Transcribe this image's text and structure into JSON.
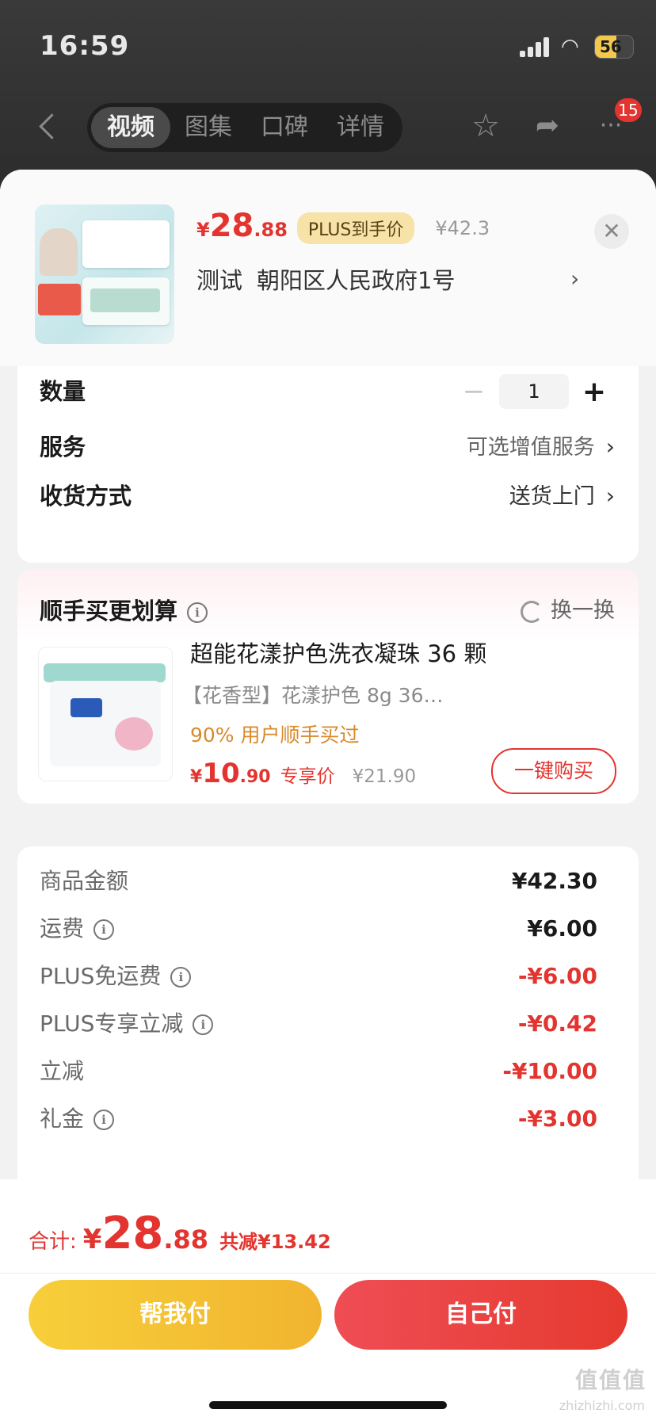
{
  "status": {
    "time": "16:59",
    "battery": "56",
    "battery_level": 0.56
  },
  "nav": {
    "tabs": [
      "视频",
      "图集",
      "口碑",
      "详情"
    ],
    "badge": "15"
  },
  "product": {
    "price_yen": "¥",
    "price_int": "28",
    "price_dec": ".88",
    "plus_label": "PLUS到手价",
    "original_price": "¥42.3",
    "address_name": "测试",
    "address": "朝阳区人民政府1号",
    "chevron": "›"
  },
  "options": {
    "quantity_label": "数量",
    "quantity": "1",
    "minus": "−",
    "plus": "+",
    "service_label": "服务",
    "service_value": "可选增值服务",
    "delivery_label": "收货方式",
    "delivery_value": "送货上门",
    "chevron": "›"
  },
  "recommend": {
    "title": "顺手买更划算",
    "refresh": "换一换",
    "info": "i",
    "item": {
      "name": "超能花漾护色洗衣凝珠 36 颗",
      "spec": "【花香型】花漾护色 8g 36…",
      "bought": "90% 用户顺手买过",
      "price_yen": "¥",
      "price_int": "10",
      "price_dec": ".90",
      "price_label": "专享价",
      "old_price": "¥21.90",
      "buy_label": "一键购买"
    }
  },
  "fees": [
    {
      "label": "商品金额",
      "value": "¥42.30",
      "info": false,
      "red": false
    },
    {
      "label": "运费",
      "value": "¥6.00",
      "info": true,
      "red": false
    },
    {
      "label": "PLUS免运费",
      "value": "-¥6.00",
      "info": true,
      "red": true
    },
    {
      "label": "PLUS专享立减",
      "value": "-¥0.42",
      "info": true,
      "red": true
    },
    {
      "label": "立减",
      "value": "-¥10.00",
      "info": false,
      "red": true
    },
    {
      "label": "礼金",
      "value": "-¥3.00",
      "info": true,
      "red": true
    }
  ],
  "total": {
    "label": "合计:",
    "yen": "¥",
    "int": "28",
    "dec": ".88",
    "saved": "共减¥13.42"
  },
  "buttons": {
    "help_pay": "帮我付",
    "self_pay": "自己付"
  },
  "watermark": {
    "text": "值值值",
    "domain": "zhizhizhi.com"
  },
  "colors": {
    "accent_red": "#e3342f",
    "help_yellow": "#f7cf3a",
    "plus_gold": "#f7e2a8"
  }
}
